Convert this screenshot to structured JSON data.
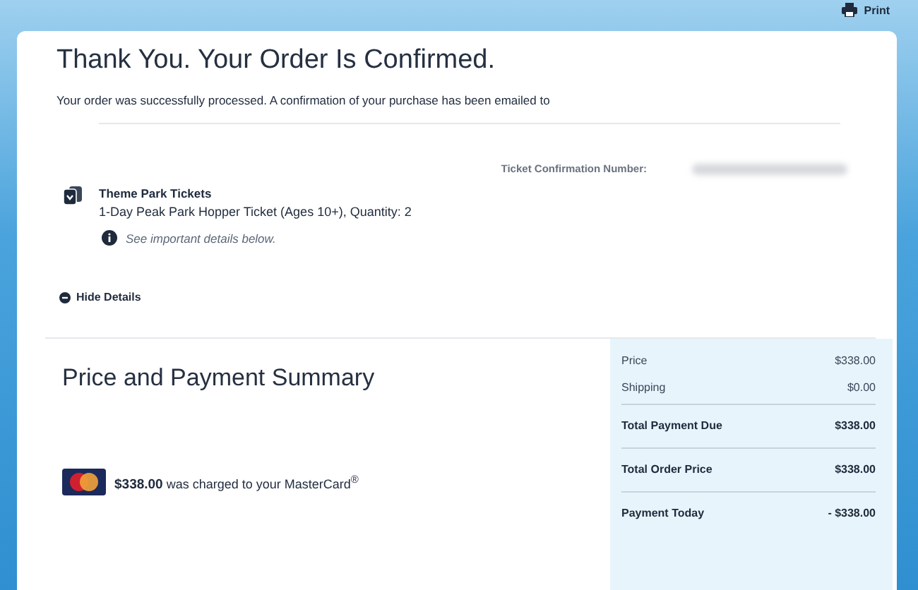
{
  "print_button": {
    "label": "Print"
  },
  "confirmation": {
    "title": "Thank You. Your Order Is Confirmed.",
    "message": "Your order was successfully processed. A confirmation of your purchase has been emailed to",
    "ticket_number_label": "Ticket Confirmation Number:"
  },
  "order_item": {
    "title": "Theme Park Tickets",
    "description": "1-Day Peak Park Hopper Ticket (Ages 10+), Quantity: 2",
    "note": "See important details below."
  },
  "details_toggle": {
    "label": "Hide Details",
    "expanded": true
  },
  "payment": {
    "title": "Price and Payment Summary",
    "charge_amount": "$338.00",
    "charge_text": "was charged to your MasterCard$^{®}$"
  },
  "summary": [
    {
      "label": "Price",
      "value": "$338.00",
      "kind": "line"
    },
    {
      "label": "Shipping",
      "value": "$0.00",
      "kind": "line"
    },
    {
      "label": "Total Payment Due",
      "value": "$338.00",
      "kind": "total"
    },
    {
      "label": "Total Order Price",
      "value": "$338.00",
      "kind": "total"
    },
    {
      "label": "Payment Today",
      "value": "- $338.00",
      "kind": "total"
    }
  ]
}
